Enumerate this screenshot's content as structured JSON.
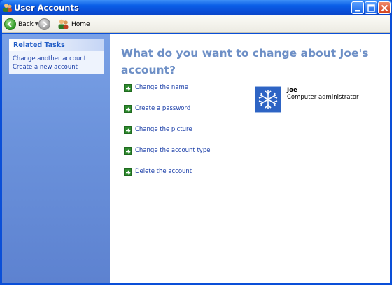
{
  "window": {
    "title": "User Accounts"
  },
  "toolbar": {
    "back_label": "Back",
    "home_label": "Home"
  },
  "sidebar": {
    "panel_title": "Related Tasks",
    "links": [
      "Change another account",
      "Create a new account"
    ]
  },
  "main": {
    "heading": "What do you want to change about Joe's account?",
    "options": [
      "Change the name",
      "Create a password",
      "Change the picture",
      "Change the account type",
      "Delete the account"
    ]
  },
  "user": {
    "name": "Joe",
    "role": "Computer administrator",
    "picture_icon": "snowflake-icon"
  },
  "colors": {
    "titlebar": "#0a4fd8",
    "sidebar": "#6c93dc",
    "heading": "#6d8fc6",
    "link": "#1a3ea8",
    "option_arrow": "#2d8a2d"
  }
}
